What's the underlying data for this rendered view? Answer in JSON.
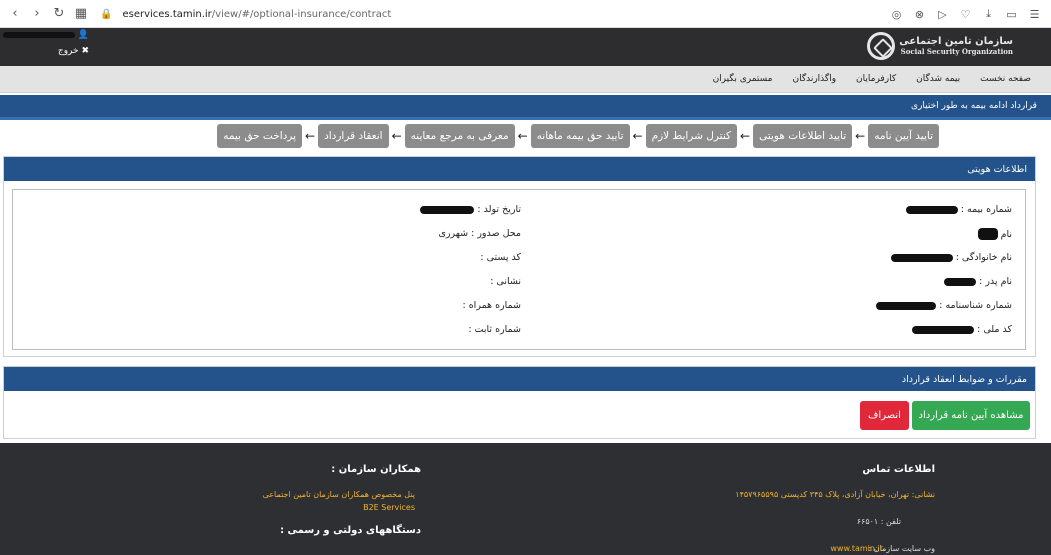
{
  "browser": {
    "url_host": "eservices.tamin.ir",
    "url_path": "/view/#/optional-insurance/contract"
  },
  "header": {
    "logo_fa": "سازمان تامین اجتماعی",
    "logo_en": "Social Security Organization",
    "logout_label": "خروج"
  },
  "nav": {
    "items": [
      "صفحه نخست",
      "بیمه شدگان",
      "کارفرمایان",
      "واگذارندگان",
      "مستمری بگیران"
    ]
  },
  "page": {
    "title": "قرارداد ادامه بیمه به طور اختیاری"
  },
  "steps": [
    "تایید آیین نامه",
    "تایید اطلاعات هویتی",
    "کنترل شرایط لازم",
    "تایید حق بیمه ماهانه",
    "معرفی به مرجع معاینه",
    "انعقاد قرارداد",
    "پرداخت حق بیمه"
  ],
  "identity": {
    "heading": "اطلاعات هویتی",
    "insurance_number": "شماره بیمه :",
    "first_name": "نام",
    "last_name": "نام خانوادگی :",
    "father_name": "نام پدر :",
    "id_number": "شماره شناسنامه :",
    "national_code": "کد ملی :",
    "birth_date": "تاریخ تولد :",
    "issue_place": "محل صدور : شهرری",
    "postal_code": "کد پستی :",
    "address": "نشانی :",
    "mobile": "شماره همراه :",
    "phone": "شماره ثابت :"
  },
  "rules": {
    "heading": "مقررات و ضوابط انعقاد قرارداد",
    "view_button": "مشاهده آیین نامه قرارداد",
    "cancel_button": "انصراف"
  },
  "footer": {
    "contact_heading": "اطلاعات تماس",
    "address": "نشانی: تهران، خیابان آزادی، پلاک ۳۴۵ کدپستی ۱۴۵۷۹۶۵۵۹۵",
    "phone": "تلفن : ۶۶۵۰۱",
    "website_label": "وب سایت سازمان :",
    "website": "www.tamin.ir",
    "partners_heading": "همکاران سازمان :",
    "partners_panel": "پنل مخصوص همکاران سازمان تامین اجتماعی",
    "b2e": "B2E Services",
    "gov_heading": "دستگاههای دولتی و رسمی :"
  }
}
